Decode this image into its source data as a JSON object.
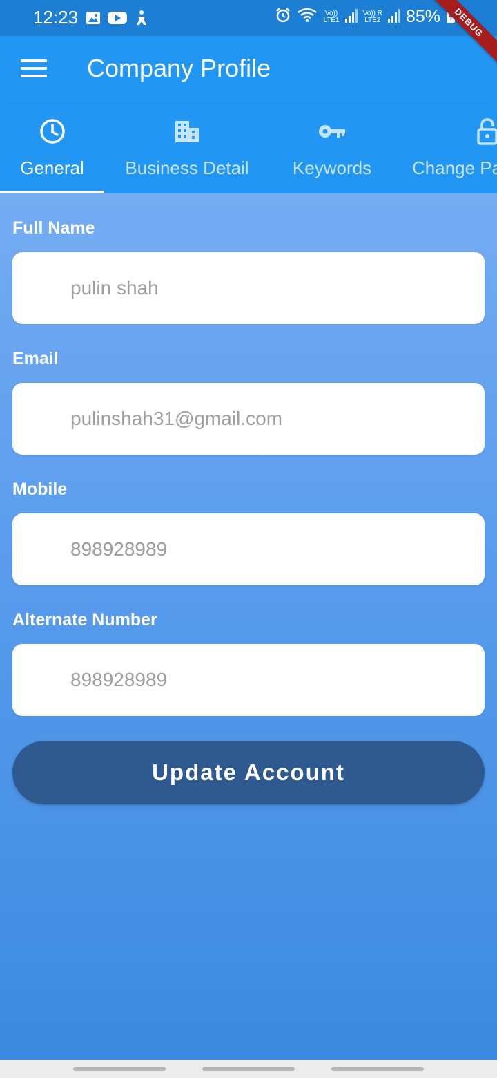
{
  "status_bar": {
    "time": "12:23",
    "battery": "85%",
    "sim1_label": "Vo))\nLTE1",
    "sim2_label": "Vo))\nLTE2",
    "roaming": "R",
    "icons": [
      "image-icon",
      "youtube-icon",
      "accessibility-icon",
      "alarm-icon",
      "wifi-icon",
      "signal-icon",
      "signal-icon",
      "battery-charging-icon"
    ]
  },
  "debug_banner": "DEBUG",
  "app_bar": {
    "title": "Company Profile",
    "menu_icon": "hamburger-menu-icon"
  },
  "tabs": [
    {
      "label": "General",
      "icon": "clock-icon",
      "active": true
    },
    {
      "label": "Business Detail",
      "icon": "building-icon",
      "active": false
    },
    {
      "label": "Keywords",
      "icon": "key-icon",
      "active": false
    },
    {
      "label": "Change Pa",
      "icon": "lock-icon",
      "active": false
    }
  ],
  "form": {
    "full_name": {
      "label": "Full Name",
      "placeholder": "pulin shah"
    },
    "email": {
      "label": "Email",
      "placeholder": "pulinshah31@gmail.com"
    },
    "mobile": {
      "label": "Mobile",
      "placeholder": "898928989"
    },
    "alternate": {
      "label": "Alternate Number",
      "placeholder": "898928989"
    }
  },
  "update_button": "Update Account",
  "colors": {
    "app_bar": "#2196f3",
    "status_bar": "#1c7fd3",
    "button": "#2f5a8f",
    "debug_ribbon": "#a51d1d"
  }
}
